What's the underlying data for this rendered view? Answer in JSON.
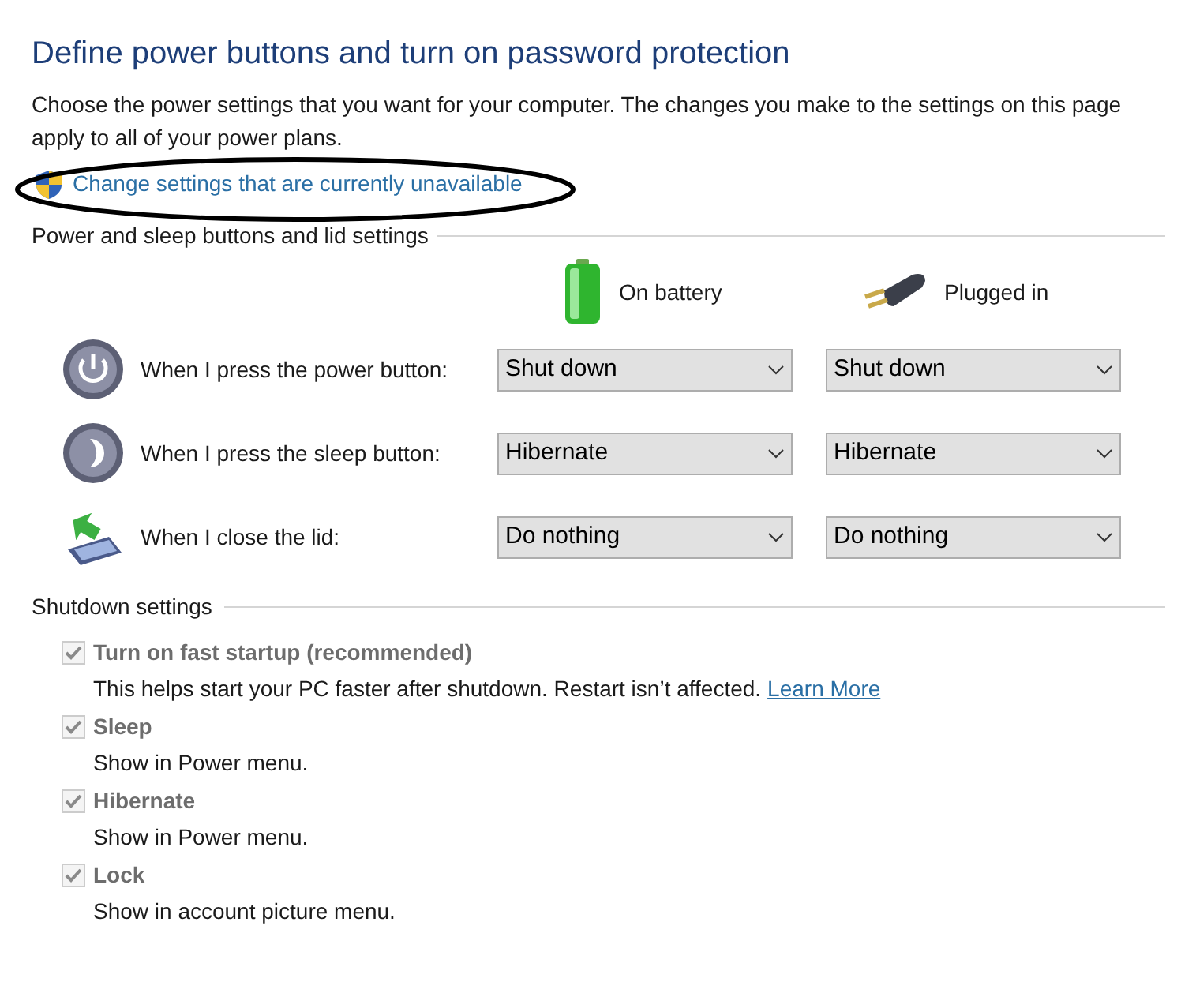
{
  "title": "Define power buttons and turn on password protection",
  "description": "Choose the power settings that you want for your computer. The changes you make to the settings on this page apply to all of your power plans.",
  "admin_link": "Change settings that are currently unavailable",
  "power_section": {
    "heading": "Power and sleep buttons and lid settings",
    "columns": [
      {
        "kind": "battery",
        "label": "On battery"
      },
      {
        "kind": "plug",
        "label": "Plugged in"
      }
    ],
    "rows": [
      {
        "kind": "power",
        "label": "When I press the power button:",
        "values": [
          "Shut down",
          "Shut down"
        ]
      },
      {
        "kind": "sleep",
        "label": "When I press the sleep button:",
        "values": [
          "Hibernate",
          "Hibernate"
        ]
      },
      {
        "kind": "lid",
        "label": "When I close the lid:",
        "values": [
          "Do nothing",
          "Do nothing"
        ]
      }
    ]
  },
  "shutdown_section": {
    "heading": "Shutdown settings",
    "options": [
      {
        "label": "Turn on fast startup (recommended)",
        "checked": true,
        "disabled": true,
        "description": "This helps start your PC faster after shutdown. Restart isn’t affected.",
        "link": "Learn More"
      },
      {
        "label": "Sleep",
        "checked": true,
        "disabled": true,
        "description": "Show in Power menu."
      },
      {
        "label": "Hibernate",
        "checked": true,
        "disabled": true,
        "description": "Show in Power menu."
      },
      {
        "label": "Lock",
        "checked": true,
        "disabled": true,
        "description": "Show in account picture menu."
      }
    ]
  }
}
